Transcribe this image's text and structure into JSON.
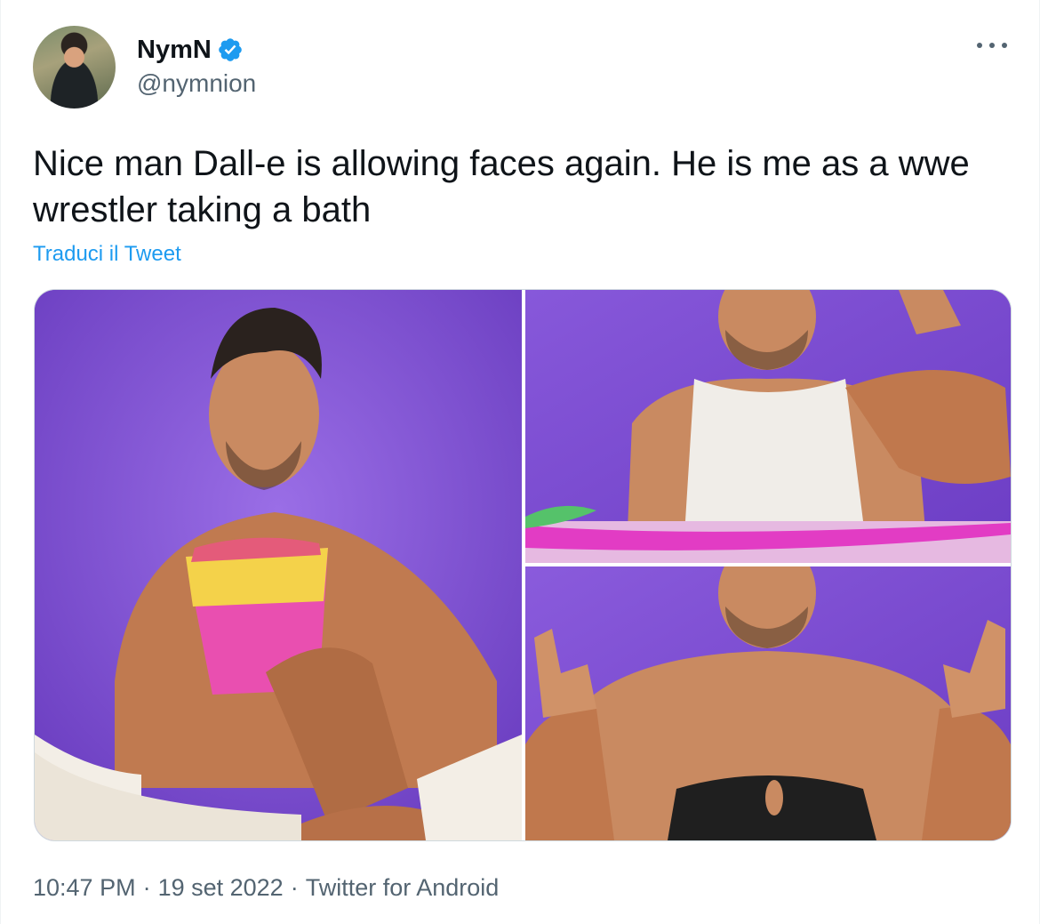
{
  "author": {
    "display_name": "NymN",
    "handle": "@nymnion",
    "verified": true
  },
  "tweet": {
    "text": "Nice man Dall-e is allowing faces again. He is me as a wwe wrestler taking a bath",
    "translate_label": "Traduci il Tweet"
  },
  "media": [
    {
      "semantic": "man-in-bathtub-holding-snack-bag"
    },
    {
      "semantic": "man-flexing-arm-in-tank-top"
    },
    {
      "semantic": "man-giving-thumbs-up"
    }
  ],
  "meta": {
    "time": "10:47 PM",
    "separator": "·",
    "date": "19 set 2022",
    "source": "Twitter for Android"
  },
  "colors": {
    "link": "#1d9bf0",
    "secondary_text": "#536471",
    "verified_badge": "#1d9bf0",
    "media_background": "#7a4fcf"
  },
  "icons": [
    "verified-badge-icon",
    "more-options-icon"
  ]
}
